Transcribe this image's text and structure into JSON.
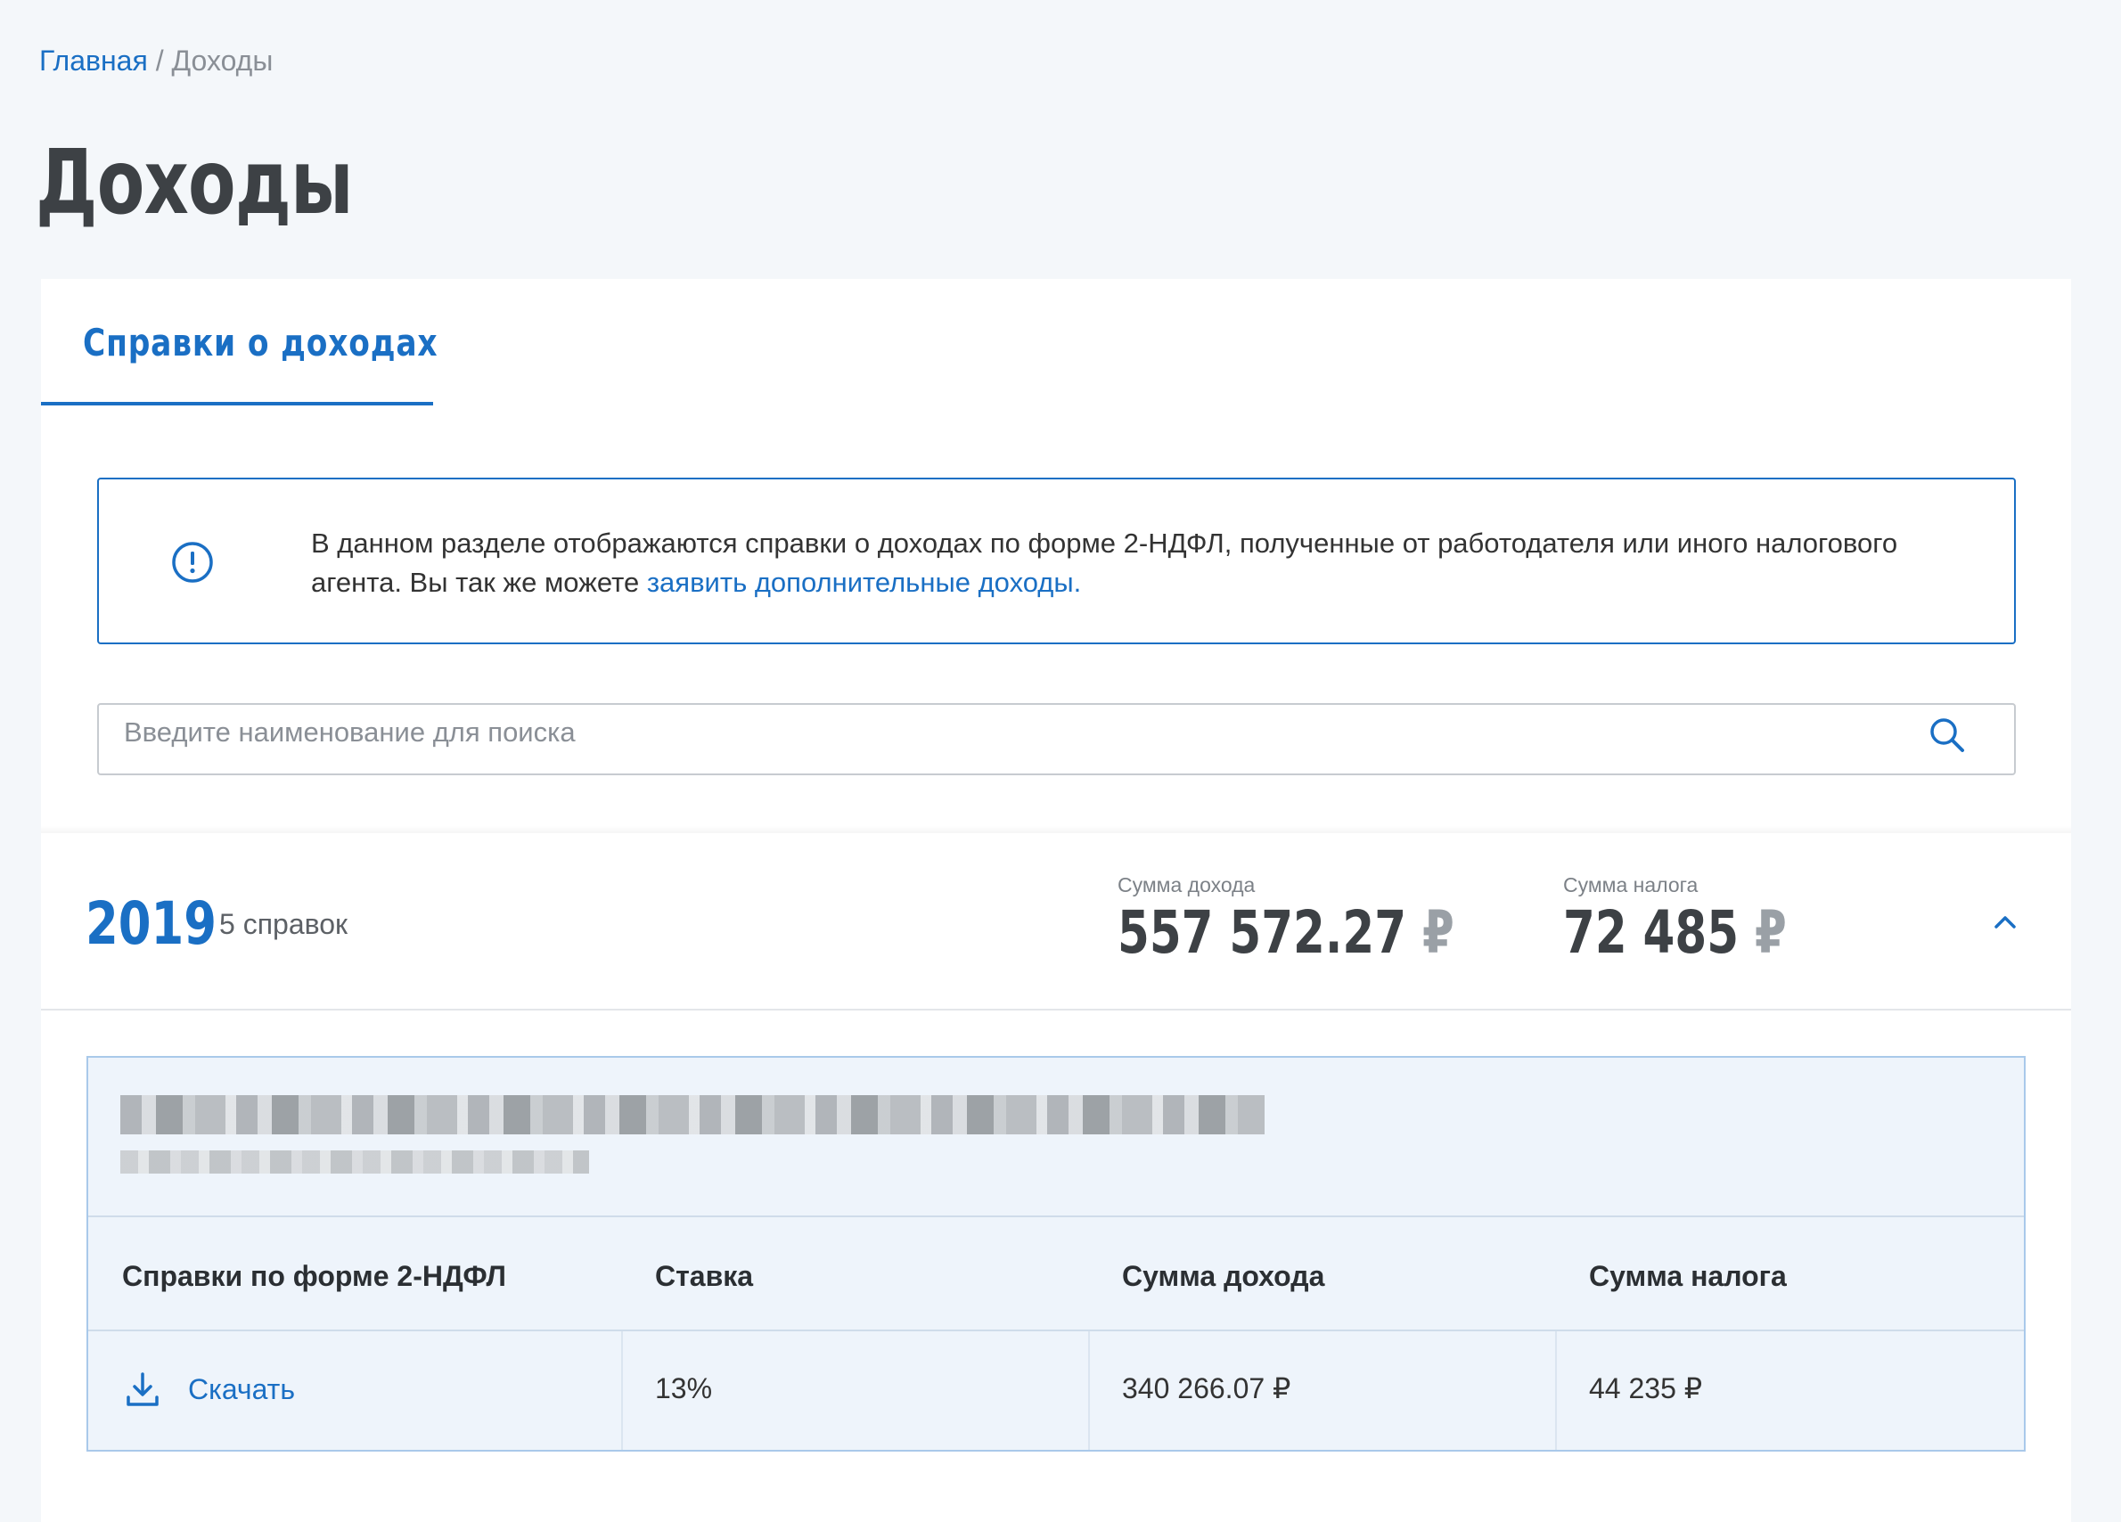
{
  "breadcrumb": {
    "home": "Главная",
    "separator": "/",
    "current": "Доходы"
  },
  "page": {
    "title": "Доходы"
  },
  "tabs": [
    {
      "label": "Справки о доходах",
      "active": true
    }
  ],
  "notice": {
    "icon": "exclamation-circle-icon",
    "text_before": "В данном разделе отображаются справки о доходах по форме 2-НДФЛ, полученные от работодателя или иного налогового агента. Вы так же можете ",
    "link_text": "заявить дополнительные доходы."
  },
  "search": {
    "placeholder": "Введите наименование для поиска",
    "value": "",
    "icon": "search-icon"
  },
  "year_group": {
    "year": "2019",
    "count_label": "5 справок",
    "income_label": "Сумма дохода",
    "income_value": "557 572.27",
    "tax_label": "Сумма налога",
    "tax_value": "72 485",
    "currency": "₽",
    "expanded": true
  },
  "employer": {
    "name": "",
    "inn": "",
    "redacted": true,
    "table": {
      "headers": [
        "Справки по форме 2-НДФЛ",
        "Ставка",
        "Сумма дохода",
        "Сумма налога"
      ],
      "rows": [
        {
          "download_label": "Скачать",
          "rate": "13%",
          "income": "340 266.07 ₽",
          "tax": "44 235 ₽"
        }
      ]
    }
  },
  "colors": {
    "accent": "#1a6fc4",
    "page_background": "#f4f7fa",
    "employer_background": "#eef4fb",
    "title_text": "#3d4145"
  }
}
